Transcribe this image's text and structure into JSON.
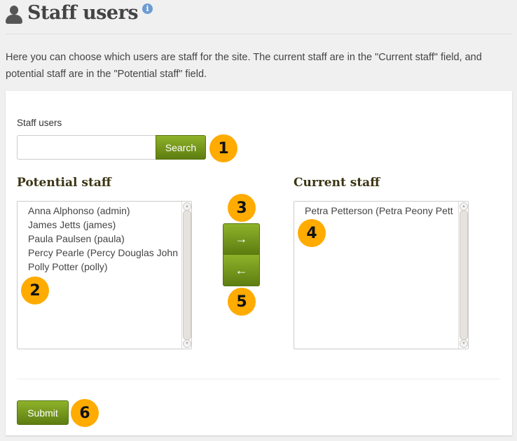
{
  "header": {
    "title": "Staff users",
    "user_icon": "user-icon",
    "info_icon": "info-icon",
    "info_glyph": "i"
  },
  "description": "Here you can choose which users are staff for the site. The current staff are in the \"Current staff\" field, and potential staff are in the \"Potential staff\" field.",
  "form": {
    "search_label": "Staff users",
    "search_value": "",
    "search_placeholder": "",
    "search_button": "Search",
    "potential_title": "Potential staff",
    "potential_items": [
      "Anna Alphonso (admin)",
      "James Jetts (james)",
      "Paula Paulsen (paula)",
      "Percy Pearle (Percy Douglas John",
      "Polly Potter (polly)"
    ],
    "current_title": "Current staff",
    "current_items": [
      "Petra Petterson (Petra Peony Pett"
    ],
    "move_right_glyph": "→",
    "move_left_glyph": "←",
    "submit_button": "Submit"
  },
  "annotations": [
    "1",
    "2",
    "3",
    "4",
    "5",
    "6"
  ],
  "colors": {
    "button_green": "#7a9a1e",
    "badge_orange": "#ffab00",
    "info_blue": "#6c9bd2"
  }
}
